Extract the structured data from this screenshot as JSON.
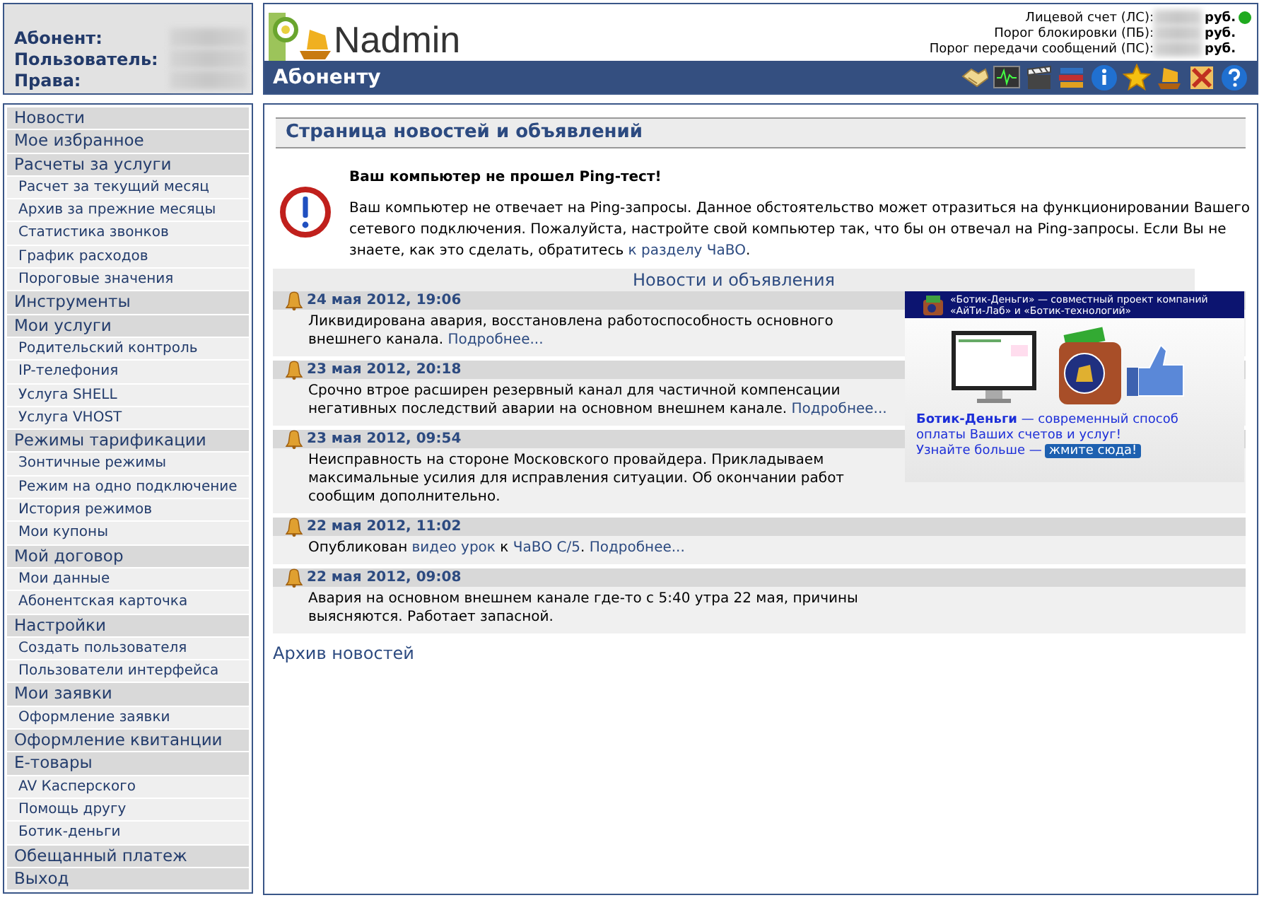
{
  "user_panel": {
    "labels": [
      "Абонент:",
      "Пользователь:",
      "Права:"
    ]
  },
  "header": {
    "logo": "Nadmin",
    "section_title": "Абоненту",
    "account": [
      {
        "label": "Лицевой счет (ЛС):",
        "unit": "руб.",
        "status": true
      },
      {
        "label": "Порог блокировки (ПБ):",
        "unit": "руб.",
        "status": false
      },
      {
        "label": "Порог передачи сообщений (ПС):",
        "unit": "руб.",
        "status": false
      }
    ]
  },
  "sidebar": {
    "items": [
      {
        "label": "Новости"
      },
      {
        "label": "Мое избранное"
      },
      {
        "label": "Расчеты за услуги",
        "children": [
          {
            "label": "Расчет за текущий месяц"
          },
          {
            "label": "Архив за прежние месяцы"
          },
          {
            "label": "Статистика звонков"
          },
          {
            "label": "График расходов"
          },
          {
            "label": "Пороговые значения"
          }
        ]
      },
      {
        "label": "Инструменты"
      },
      {
        "label": "Мои услуги",
        "children": [
          {
            "label": "Родительский контроль"
          },
          {
            "label": "IP-телефония"
          },
          {
            "label": "Услуга SHELL"
          },
          {
            "label": "Услуга VHOST"
          }
        ]
      },
      {
        "label": "Режимы тарификации",
        "children": [
          {
            "label": "Зонтичные режимы"
          },
          {
            "label": "Режим на одно подключение"
          },
          {
            "label": "История режимов"
          },
          {
            "label": "Мои купоны"
          }
        ]
      },
      {
        "label": "Мой договор",
        "children": [
          {
            "label": "Мои данные"
          },
          {
            "label": "Абонентская карточка"
          }
        ]
      },
      {
        "label": "Настройки",
        "children": [
          {
            "label": "Создать пользователя"
          },
          {
            "label": "Пользователи интерфейса"
          }
        ]
      },
      {
        "label": "Мои заявки",
        "children": [
          {
            "label": "Оформление заявки"
          }
        ]
      },
      {
        "label": "Оформление квитанции"
      },
      {
        "label": "Е-товары",
        "children": [
          {
            "label": "AV Касперского"
          },
          {
            "label": "Помощь другу"
          },
          {
            "label": "Ботик-деньги"
          }
        ]
      },
      {
        "label": "Обещанный платеж"
      },
      {
        "label": "Выход"
      }
    ]
  },
  "main": {
    "title": "Страница новостей и объявлений",
    "alert": {
      "title": "Ваш компьютер не прошел Ping-тест!",
      "parts": [
        {
          "text": "Ваш компьютер не отвечает на Ping-запросы. Данное обстоятельство может отразиться на функционировании Вашего сетевого подключения. Пожалуйста, настройте свой компьютер так, что бы он отвечал на Ping-запросы. Если Вы не знаете, как это сделать, обратитесь ",
          "link": false
        },
        {
          "text": "к разделу ЧаВО",
          "link": true
        },
        {
          "text": ".",
          "link": false
        }
      ]
    },
    "news_heading": "Новости и объявления",
    "news": [
      {
        "date": "24 мая 2012, 19:06",
        "parts": [
          {
            "text": "Ликвидирована авария, восстановлена работоспособность основного внешнего канала. ",
            "link": false
          },
          {
            "text": "Подробнее...",
            "link": true
          }
        ]
      },
      {
        "date": "23 мая 2012, 20:18",
        "parts": [
          {
            "text": "Срочно втрое расширен резервный канал для частичной компенсации негативных последствий аварии на основном внешнем канале. ",
            "link": false
          },
          {
            "text": "Подробнее...",
            "link": true
          }
        ]
      },
      {
        "date": "23 мая 2012, 09:54",
        "parts": [
          {
            "text": "Неисправность на стороне Московского провайдера. Прикладываем максимальные усилия для исправления ситуации. Об окончании работ сообщим дополнительно.",
            "link": false
          }
        ]
      },
      {
        "date": "22 мая 2012, 11:02",
        "parts": [
          {
            "text": "Опубликован ",
            "link": false
          },
          {
            "text": "видео урок",
            "link": true
          },
          {
            "text": " к ",
            "link": false
          },
          {
            "text": "ЧаВО С/5",
            "link": true
          },
          {
            "text": ". ",
            "link": false
          },
          {
            "text": "Подробнее...",
            "link": true
          }
        ]
      },
      {
        "date": "22 мая 2012, 09:08",
        "parts": [
          {
            "text": "Авария на основном внешнем канале где-то с 5:40 утра 22 мая, причины выясняются. Работает запасной.",
            "link": false
          }
        ]
      }
    ],
    "banner": {
      "caption": "«Ботик-Деньги» — совместный проект компаний «АйТи-Лаб» и «Ботик-технологий»",
      "text": "**Ботик-Деньги** — современный способ оплаты Ваших счетов и услуг!",
      "more": "Узнайте больше —",
      "button": "жмите сюда!"
    },
    "archive_link": "Архив новостей"
  }
}
